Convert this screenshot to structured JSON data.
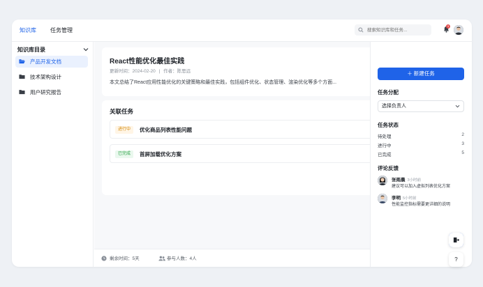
{
  "topbar": {
    "nav": [
      "知识库",
      "任务管理"
    ],
    "search_placeholder": "搜索知识库和任务...",
    "notification_count": "3"
  },
  "sidebar": {
    "title": "知识库目录",
    "items": [
      {
        "label": "产品开发文档",
        "active": true
      },
      {
        "label": "技术架构设计",
        "active": false
      },
      {
        "label": "用户研究报告",
        "active": false
      }
    ]
  },
  "document": {
    "title": "React性能优化最佳实践",
    "updated_label": "更新时间：2024-02-20",
    "author_label": "作者：陈思远",
    "separator": "|",
    "description": "本文总结了React应用性能优化的关键策略和最佳实践，包括组件优化、状态管理、渲染优化等多个方面..."
  },
  "related": {
    "title": "关联任务",
    "tasks": [
      {
        "status": "进行中",
        "name": "优化商品列表性能问题"
      },
      {
        "status": "已完成",
        "name": "首屏加载优化方案"
      }
    ]
  },
  "footer": {
    "remaining": "剩余时间：5天",
    "participants": "参与人数：4人"
  },
  "right_panel": {
    "new_task_label": "＋ 新建任务",
    "assign_title": "任务分配",
    "assign_select": "选择负责人",
    "status_title": "任务状态",
    "statuses": [
      {
        "label": "待处理",
        "count": "2"
      },
      {
        "label": "进行中",
        "count": "3"
      },
      {
        "label": "已完成",
        "count": "5"
      }
    ],
    "comments_title": "评论反馈",
    "comments": [
      {
        "name": "张雨晨",
        "time": "3小时前",
        "text": "建议可以加入虚拟列表优化方案"
      },
      {
        "name": "李明",
        "time": "5小时前",
        "text": "性能监控指标需要更详细的说明"
      }
    ]
  },
  "fabs": {
    "add": "+",
    "help": "?"
  },
  "colors": {
    "accent": "#1f63e8",
    "in_progress": "#d48806",
    "done": "#2ba245",
    "badge": "#e34d4d"
  }
}
